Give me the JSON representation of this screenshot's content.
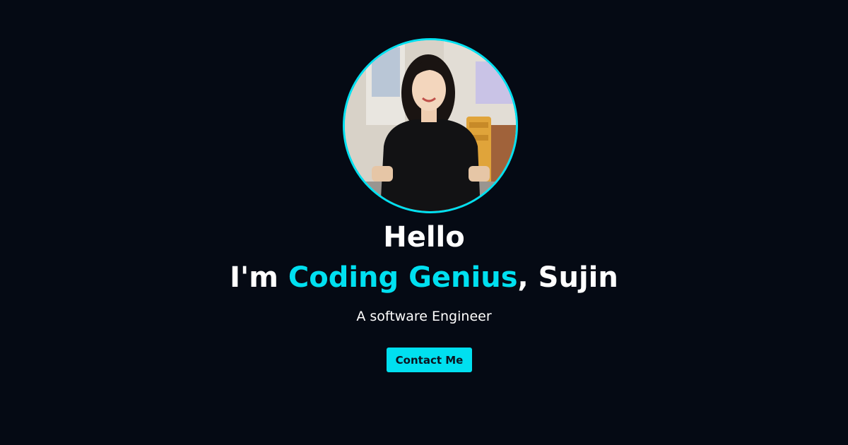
{
  "hero": {
    "greeting": "Hello",
    "intro_prefix": "I'm ",
    "intro_accent": "Coding Genius",
    "intro_suffix": ", Sujin",
    "subtitle": "A software Engineer",
    "contact_label": "Contact Me"
  },
  "colors": {
    "background": "#050a14",
    "accent": "#00e0f0",
    "text": "#ffffff"
  }
}
